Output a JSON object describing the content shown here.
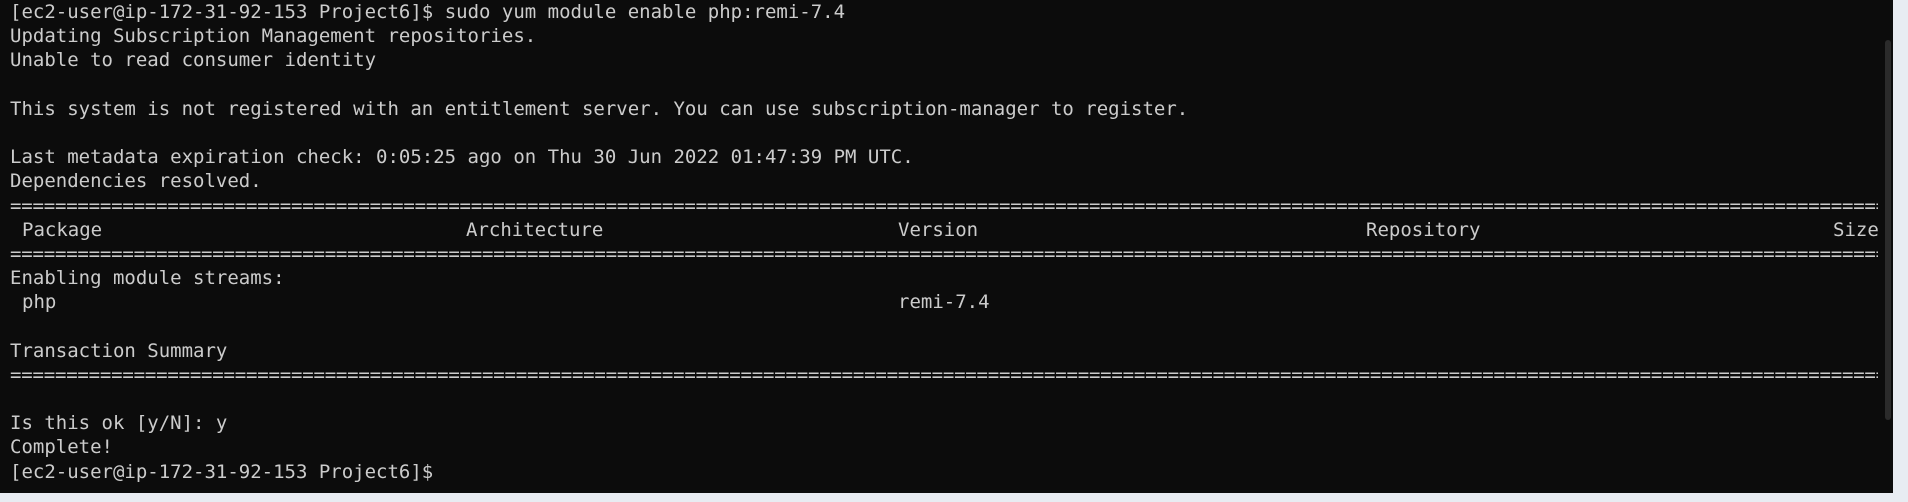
{
  "terminal": {
    "prompt": "[ec2-user@ip-172-31-92-153 Project6]$ ",
    "command": "sudo yum module enable php:remi-7.4",
    "output": [
      "Updating Subscription Management repositories.",
      "Unable to read consumer identity",
      "",
      "This system is not registered with an entitlement server. You can use subscription-manager to register.",
      "",
      "Last metadata expiration check: 0:05:25 ago on Thu 30 Jun 2022 01:47:39 PM UTC.",
      "Dependencies resolved."
    ],
    "rule": "================================================================================================================================================================================================",
    "table_headers": {
      "package": "Package",
      "architecture": "Architecture",
      "version": "Version",
      "repository": "Repository",
      "size": "Size"
    },
    "section_title": "Enabling module streams:",
    "row": {
      "package": "php",
      "version": "remi-7.4"
    },
    "summary_title": "Transaction Summary",
    "confirm_prompt": "Is this ok [y/N]: y",
    "complete": "Complete!",
    "final_prompt": "[ec2-user@ip-172-31-92-153 Project6]$"
  }
}
